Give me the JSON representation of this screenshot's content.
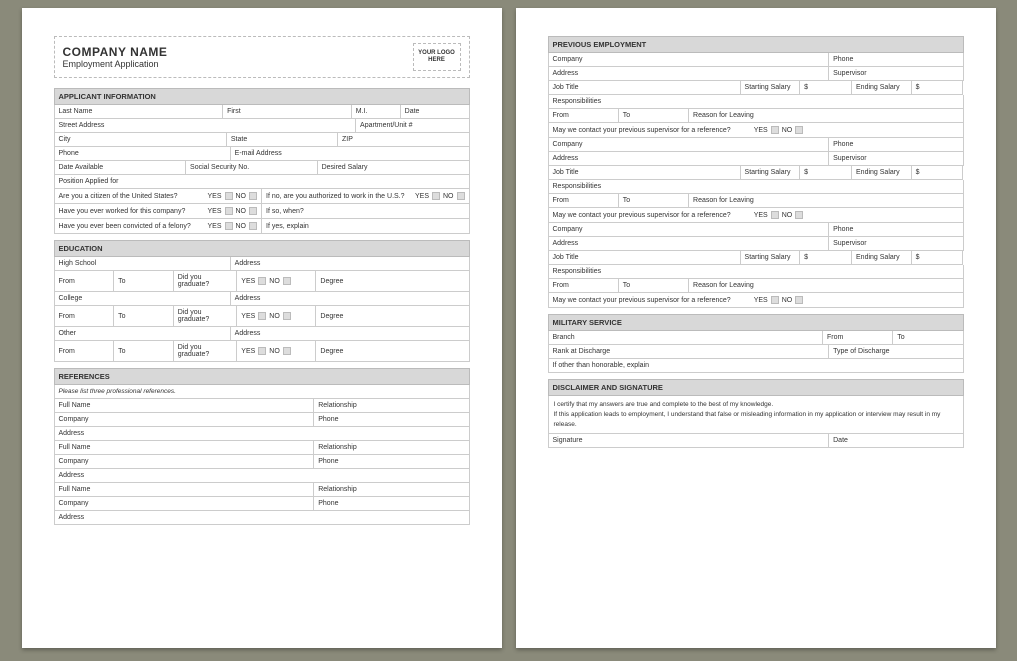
{
  "header": {
    "company": "COMPANY NAME",
    "subtitle": "Employment Application",
    "logo": "YOUR LOGO HERE"
  },
  "labels": {
    "yes": "YES",
    "no": "NO",
    "from": "From",
    "to": "To",
    "degree": "Degree",
    "dollar": "$"
  },
  "applicant": {
    "title": "APPLICANT INFORMATION",
    "last_name": "Last Name",
    "first": "First",
    "mi": "M.I.",
    "date": "Date",
    "street": "Street Address",
    "apt": "Apartment/Unit #",
    "city": "City",
    "state": "State",
    "zip": "ZIP",
    "phone": "Phone",
    "email": "E-mail Address",
    "date_avail": "Date Available",
    "ssn": "Social Security No.",
    "desired_salary": "Desired Salary",
    "position": "Position Applied for",
    "citizen_q": "Are you a citizen of the United States?",
    "authorized_q": "If no, are you authorized to work in the U.S.?",
    "worked_before_q": "Have you ever worked for this company?",
    "if_so_when": "If so, when?",
    "felony_q": "Have you ever been convicted of a felony?",
    "if_yes_explain": "If yes, explain"
  },
  "education": {
    "title": "EDUCATION",
    "high_school": "High School",
    "college": "College",
    "other": "Other",
    "address": "Address",
    "did_graduate": "Did you graduate?"
  },
  "references": {
    "title": "REFERENCES",
    "note": "Please list three professional references.",
    "full_name": "Full Name",
    "relationship": "Relationship",
    "company": "Company",
    "phone": "Phone",
    "address": "Address"
  },
  "prev_emp": {
    "title": "PREVIOUS EMPLOYMENT",
    "company": "Company",
    "phone": "Phone",
    "address": "Address",
    "supervisor": "Supervisor",
    "job_title": "Job Title",
    "start_salary": "Starting Salary",
    "end_salary": "Ending Salary",
    "responsibilities": "Responsibilities",
    "reason_leaving": "Reason for Leaving",
    "contact_q": "May we contact your previous supervisor for a reference?"
  },
  "military": {
    "title": "MILITARY SERVICE",
    "branch": "Branch",
    "rank": "Rank at Discharge",
    "type_discharge": "Type of Discharge",
    "other_explain": "If other than honorable, explain"
  },
  "disclaimer": {
    "title": "DISCLAIMER AND SIGNATURE",
    "line1": "I certify that my answers are true and complete to the best of my knowledge.",
    "line2": "If this application leads to employment, I understand that false or misleading information in my application or interview may result in my release.",
    "signature": "Signature",
    "date": "Date"
  }
}
